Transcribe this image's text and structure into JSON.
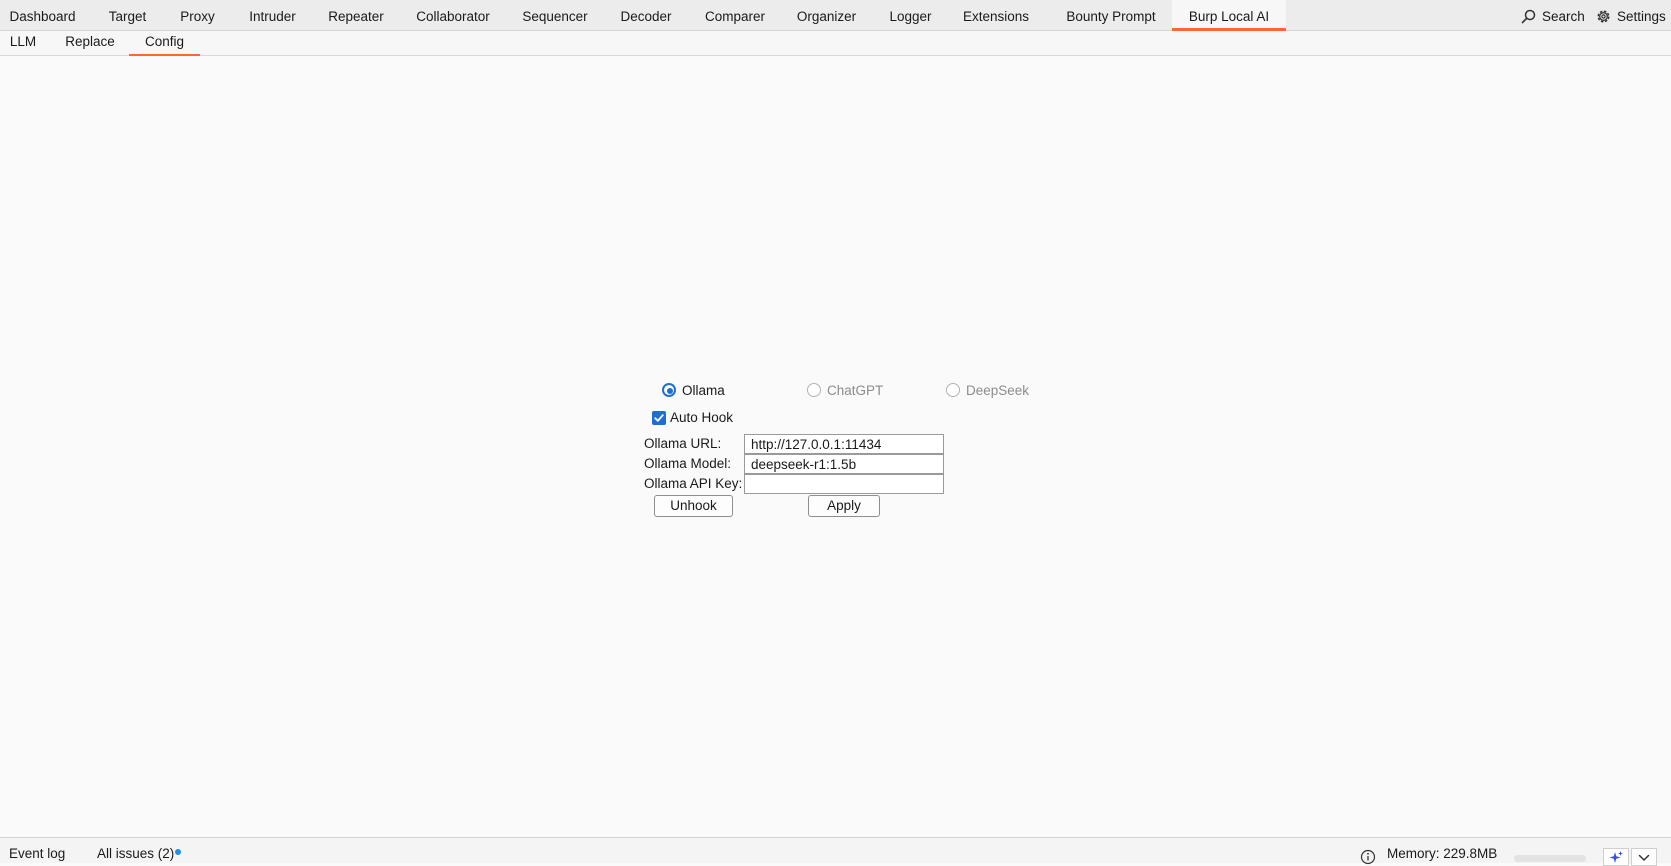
{
  "top_tabs": [
    "Dashboard",
    "Target",
    "Proxy",
    "Intruder",
    "Repeater",
    "Collaborator",
    "Sequencer",
    "Decoder",
    "Comparer",
    "Organizer",
    "Logger",
    "Extensions",
    "Bounty Prompt",
    "Burp Local AI"
  ],
  "active_top_tab": "Burp Local AI",
  "search_label": "Search",
  "settings_label": "Settings",
  "sub_tabs": [
    "LLM",
    "Replace",
    "Config"
  ],
  "active_sub_tab": "Config",
  "config": {
    "providers": [
      {
        "label": "Ollama",
        "selected": true,
        "enabled": true
      },
      {
        "label": "ChatGPT",
        "selected": false,
        "enabled": false
      },
      {
        "label": "DeepSeek",
        "selected": false,
        "enabled": false
      }
    ],
    "auto_hook": {
      "label": "Auto Hook",
      "checked": true
    },
    "fields": [
      {
        "label": "Ollama URL:",
        "value": "http://127.0.0.1:11434"
      },
      {
        "label": "Ollama Model:",
        "value": "deepseek-r1:1.5b"
      },
      {
        "label": "Ollama API Key:",
        "value": ""
      }
    ],
    "unhook_label": "Unhook",
    "apply_label": "Apply"
  },
  "status_bar": {
    "event_log": "Event log",
    "all_issues": "All issues (2)",
    "memory": "Memory: 229.8MB"
  },
  "colors": {
    "accent": "#ff6633",
    "selection": "#1f6fd1",
    "notification_dot": "#1f8fe6"
  },
  "icons": [
    "search-icon",
    "gear-icon",
    "checkmark-icon",
    "info-icon",
    "sparkle-icon",
    "chevron-down-icon"
  ]
}
